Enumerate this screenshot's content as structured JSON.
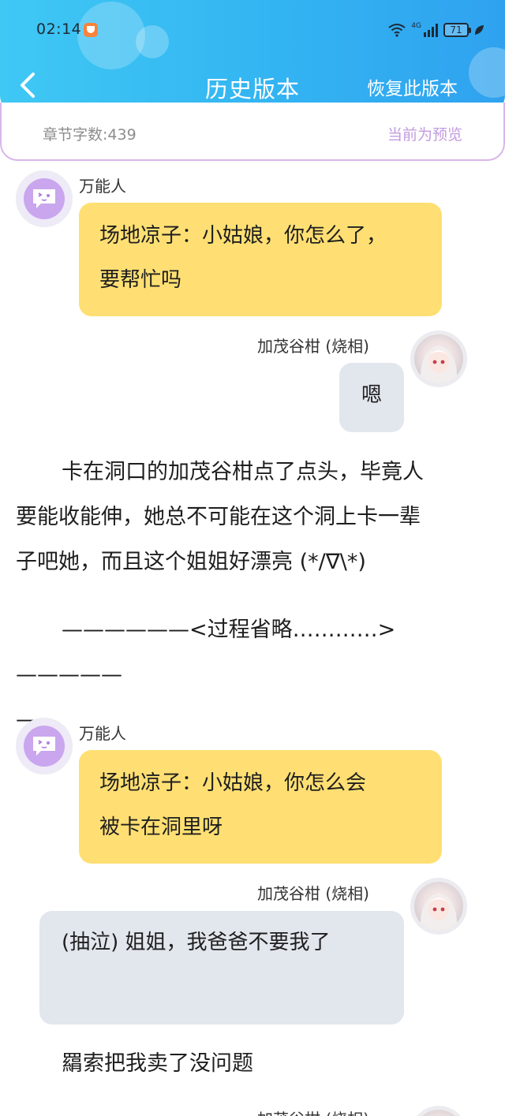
{
  "status_bar": {
    "time": "02:14",
    "network": "4G",
    "battery": "71",
    "icons": [
      "app-notification-icon",
      "wifi-icon",
      "signal-icon",
      "battery-icon",
      "leaf-icon"
    ]
  },
  "header": {
    "title": "历史版本",
    "restore_label": "恢复此版本",
    "back_icon": "chevron-left-icon"
  },
  "info_bar": {
    "word_count": "章节字数:439",
    "preview_status": "当前为预览"
  },
  "messages": [
    {
      "sender": "万能人",
      "text_line1": "场地凉子：小姑娘，你怎么了，",
      "text_line2": "要帮忙吗",
      "side": "left"
    },
    {
      "sender": "加茂谷柑 (烧相)",
      "text": "嗯",
      "side": "right"
    },
    {
      "sender": "万能人",
      "text_line1": "场地凉子：小姑娘，你怎么会",
      "text_line2": "被卡在洞里呀",
      "side": "left"
    },
    {
      "sender": "加茂谷柑 (烧相)",
      "text": "(抽泣) 姐姐，我爸爸不要我了",
      "side": "right"
    },
    {
      "sender": "加茂谷柑 (烧相)",
      "side": "right"
    }
  ],
  "narration": {
    "para1_line1": "卡在洞口的加茂谷柑点了点头，毕竟人",
    "para1_line2": "要能收能伸，她总不可能在这个洞上卡一辈",
    "para1_line3": "子吧她，而且这个姐姐好漂亮 (*/∇\\*)",
    "separator_line1": "——————<过程省略…………>—————",
    "separator_line2": "—",
    "para2": "羂索把我卖了没问题"
  },
  "colors": {
    "header_gradient_start": "#3fc8f4",
    "header_gradient_end": "#2fa2ef",
    "left_bubble": "#ffdf73",
    "right_bubble": "#e2e6ed",
    "preview_accent": "#c29be0"
  }
}
